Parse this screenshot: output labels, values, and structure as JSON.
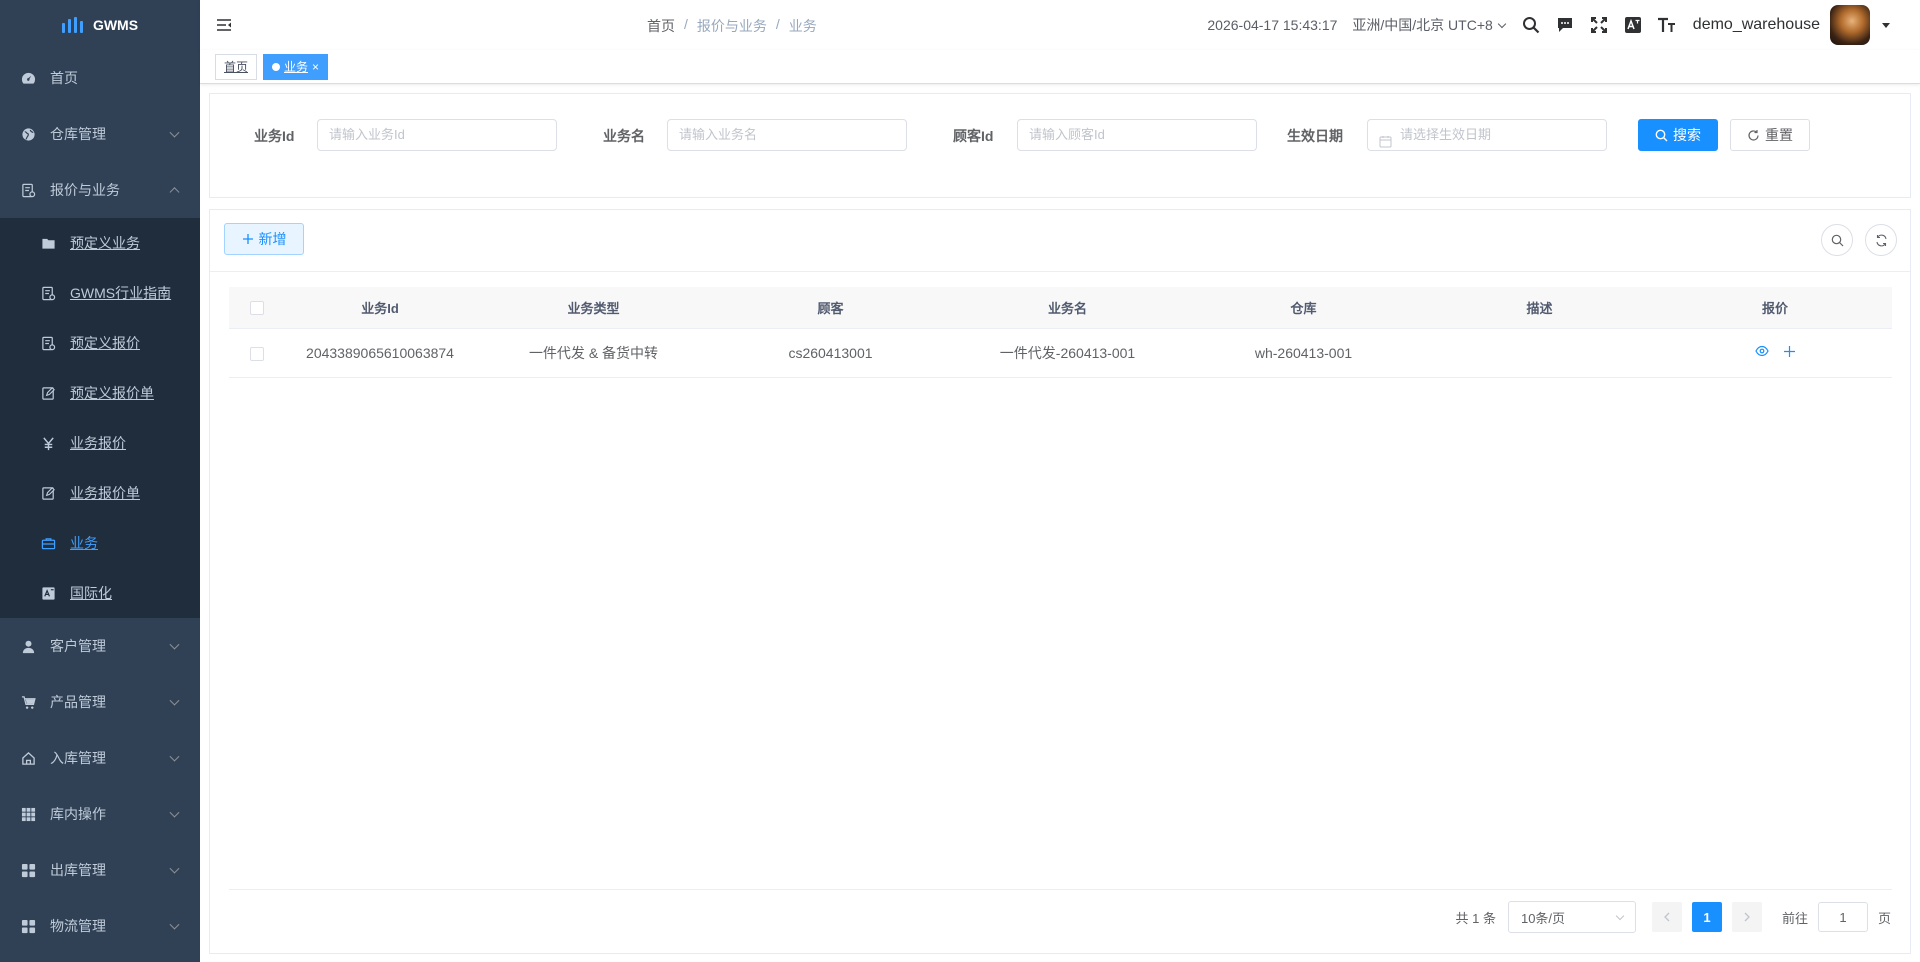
{
  "app": {
    "logo_text": "GWMS"
  },
  "sidebar": {
    "items": [
      {
        "label": "首页",
        "icon": "dashboard-icon"
      },
      {
        "label": "仓库管理",
        "icon": "globe-icon"
      },
      {
        "label": "报价与业务",
        "icon": "form-icon"
      },
      {
        "label": "客户管理",
        "icon": "user-icon"
      },
      {
        "label": "产品管理",
        "icon": "cart-icon"
      },
      {
        "label": "入库管理",
        "icon": "home-in-icon"
      },
      {
        "label": "库内操作",
        "icon": "grid-icon"
      },
      {
        "label": "出库管理",
        "icon": "apps-icon"
      },
      {
        "label": "物流管理",
        "icon": "apps-icon"
      }
    ],
    "submenu": [
      {
        "label": "预定义业务",
        "icon": "folder-icon"
      },
      {
        "label": "GWMS行业指南",
        "icon": "form-icon"
      },
      {
        "label": "预定义报价",
        "icon": "form-icon"
      },
      {
        "label": "预定义报价单",
        "icon": "edit-icon"
      },
      {
        "label": "业务报价",
        "icon": "yen-icon"
      },
      {
        "label": "业务报价单",
        "icon": "edit-icon"
      },
      {
        "label": "业务",
        "icon": "briefcase-icon"
      },
      {
        "label": "国际化",
        "icon": "translate-icon"
      }
    ]
  },
  "navbar": {
    "breadcrumb": [
      "首页",
      "报价与业务",
      "业务"
    ],
    "breadcrumb_sep": "/",
    "datetime": "2026-04-17 15:43:17",
    "timezone": "亚洲/中国/北京 UTC+8",
    "username": "demo_warehouse"
  },
  "tags": {
    "home": "首页",
    "active": "业务",
    "close": "×"
  },
  "search": {
    "fields": [
      {
        "label": "业务Id",
        "placeholder": "请输入业务Id"
      },
      {
        "label": "业务名",
        "placeholder": "请输入业务名"
      },
      {
        "label": "顾客Id",
        "placeholder": "请输入顾客Id"
      },
      {
        "label": "生效日期",
        "placeholder": "请选择生效日期"
      }
    ],
    "search_label": "搜索",
    "reset_label": "重置"
  },
  "table": {
    "add_label": "新增",
    "columns": [
      "业务Id",
      "业务类型",
      "顾客",
      "业务名",
      "仓库",
      "描述",
      "报价"
    ],
    "rows": [
      {
        "id": "2043389065610063874",
        "type": "一件代发 & 备货中转",
        "customer": "cs260413001",
        "name": "一件代发-260413-001",
        "warehouse": "wh-260413-001",
        "description": ""
      }
    ]
  },
  "pagination": {
    "total": "共 1 条",
    "page_size": "10条/页",
    "current_page": "1",
    "goto_prefix": "前往",
    "goto_value": "1",
    "goto_suffix": "页"
  },
  "colors": {
    "sidebar_bg": "#304156",
    "submenu_bg": "#1f2d3d",
    "primary": "#1890ff",
    "active_menu": "#409eff"
  }
}
